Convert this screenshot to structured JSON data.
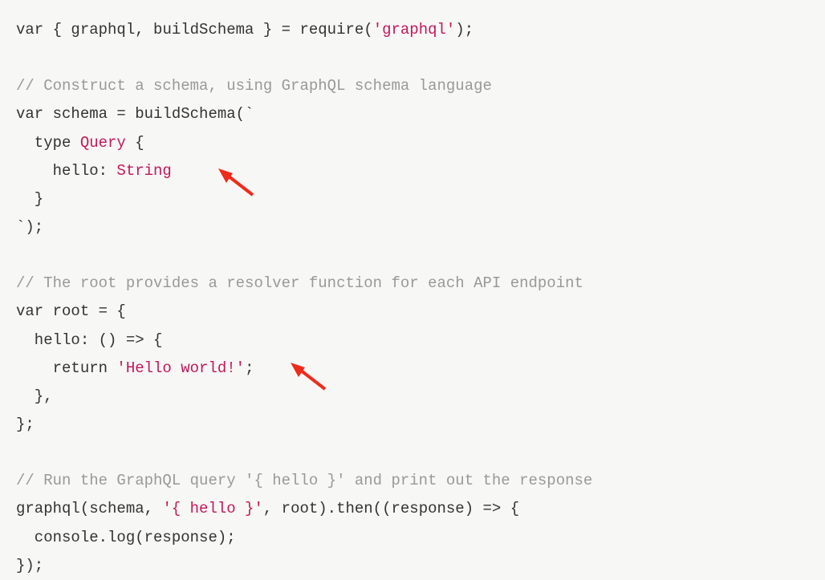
{
  "code": {
    "l1_var": "var",
    "l1_destruct": " { graphql, buildSchema } = require(",
    "l1_str": "'graphql'",
    "l1_end": ");",
    "c1": "// Construct a schema, using GraphQL schema language",
    "l2_var": "var",
    "l2_rest": " schema = buildSchema(`",
    "l3_kw": "  type",
    "l3_type": " Query",
    "l3_brace": " {",
    "l4_field": "    hello: ",
    "l4_type": "String",
    "l5_close": "  }",
    "l6_close": "`);",
    "c2": "// The root provides a resolver function for each API endpoint",
    "l7_var": "var",
    "l7_rest": " root = {",
    "l8": "  hello: () => {",
    "l9_ret": "    return ",
    "l9_str": "'Hello world!'",
    "l9_end": ";",
    "l10": "  },",
    "l11": "};",
    "c3": "// Run the GraphQL query '{ hello }' and print out the response",
    "l12_a": "graphql(schema, ",
    "l12_str": "'{ hello }'",
    "l12_b": ", root).then((response) => {",
    "l13": "  console.log(response);",
    "l14": "});"
  }
}
